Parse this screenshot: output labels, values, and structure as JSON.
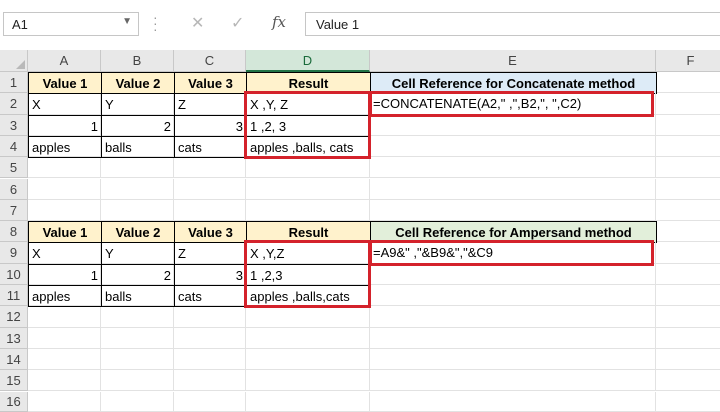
{
  "formula_bar": {
    "name_box": "A1",
    "cancel_icon": "✕",
    "enter_icon": "✓",
    "fx_label": "fx",
    "formula_value": "Value 1"
  },
  "columns": [
    "A",
    "B",
    "C",
    "D",
    "E",
    "F"
  ],
  "rows": [
    "1",
    "2",
    "3",
    "4",
    "5",
    "6",
    "7",
    "8",
    "9",
    "10",
    "11",
    "12",
    "13",
    "14",
    "15",
    "16"
  ],
  "table1": {
    "headers": [
      "Value 1",
      "Value 2",
      "Value 3",
      "Result",
      "Cell Reference for Concatenate method"
    ],
    "rows": [
      [
        "X",
        "Y",
        "Z",
        "X ,Y, Z",
        "=CONCATENATE(A2,\" ,\",B2,\", \",C2)"
      ],
      [
        "1",
        "2",
        "3",
        "1 ,2, 3",
        ""
      ],
      [
        "apples",
        "balls",
        "cats",
        "apples ,balls, cats",
        ""
      ]
    ]
  },
  "table2": {
    "headers": [
      "Value 1",
      "Value 2",
      "Value 3",
      "Result",
      "Cell Reference for Ampersand method"
    ],
    "rows": [
      [
        "X",
        "Y",
        "Z",
        "X ,Y,Z",
        "=A9&\" ,\"&B9&\",\"&C9"
      ],
      [
        "1",
        "2",
        "3",
        "1 ,2,3",
        ""
      ],
      [
        "apples",
        "balls",
        "cats",
        "apples ,balls,cats",
        ""
      ]
    ]
  },
  "colors": {
    "header_yellow": "#fff2cc",
    "header_blue": "#ddebf7",
    "header_green": "#e2efda",
    "highlight_red": "#d4222b",
    "selected_column": "#217346"
  }
}
